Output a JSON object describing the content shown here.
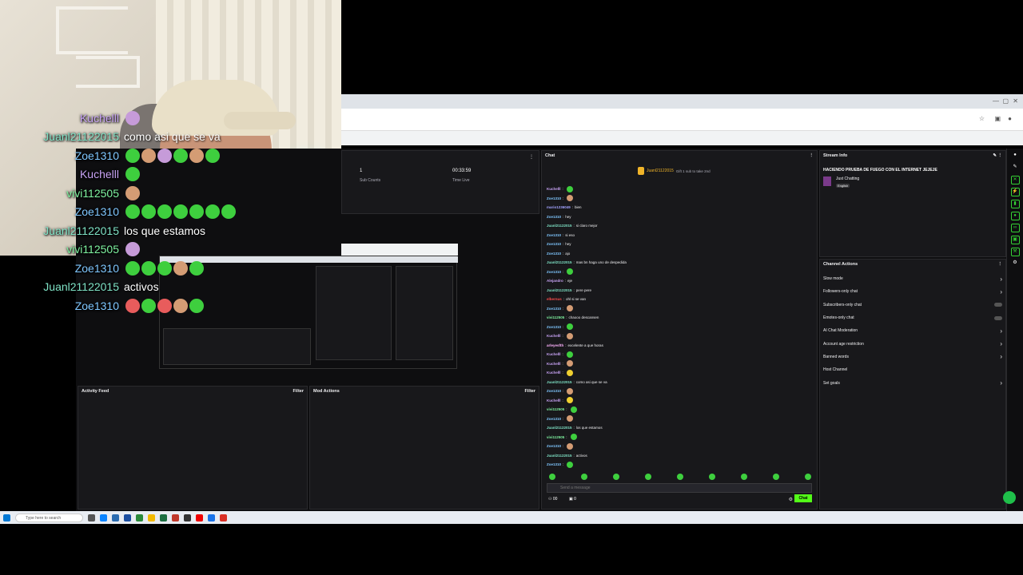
{
  "overlay_chat": [
    {
      "name": "Kuchelll",
      "color": "#c8a3f5",
      "text": "",
      "emotes": [
        "p"
      ]
    },
    {
      "name": "Juanl21122015",
      "color": "#7fe3c6",
      "text": "como asi que se va",
      "emotes": []
    },
    {
      "name": "Zoe1310",
      "color": "#7fc7ff",
      "text": "",
      "emotes": [
        "g",
        "t",
        "p",
        "g",
        "t",
        "g"
      ]
    },
    {
      "name": "Kuchelll",
      "color": "#c8a3f5",
      "text": "",
      "emotes": [
        "g"
      ]
    },
    {
      "name": "vivi112505",
      "color": "#7ff3a0",
      "text": "",
      "emotes": [
        "t"
      ]
    },
    {
      "name": "Zoe1310",
      "color": "#7fc7ff",
      "text": "",
      "emotes": [
        "g",
        "g",
        "g",
        "g",
        "g",
        "g",
        "g"
      ]
    },
    {
      "name": "Juanl21122015",
      "color": "#7fe3c6",
      "text": "los que estamos",
      "emotes": []
    },
    {
      "name": "vivi112505",
      "color": "#7ff3a0",
      "text": "",
      "emotes": [
        "p"
      ]
    },
    {
      "name": "Zoe1310",
      "color": "#7fc7ff",
      "text": "",
      "emotes": [
        "g",
        "g",
        "g",
        "t",
        "g"
      ]
    },
    {
      "name": "Juanl21122015",
      "color": "#7fe3c6",
      "text": "activos",
      "emotes": []
    },
    {
      "name": "Zoe1310",
      "color": "#7fc7ff",
      "text": "",
      "emotes": [
        "r",
        "g",
        "r",
        "t",
        "g"
      ]
    }
  ],
  "stats": {
    "sub_count_value": "1",
    "sub_count_label": "Sub Counts",
    "time_live_value": "00:33:59",
    "time_live_label": "Time Live"
  },
  "chat": {
    "title": "Chat",
    "top_user": "Juanl21122015",
    "top_note": "Gift 1 sub to take 2nd",
    "placeholder": "Send a message",
    "points": "00",
    "count": "0",
    "send_label": "Chat",
    "messages": [
      {
        "name": "Kuchelll",
        "color": "#c8a3f5",
        "text": ""
      },
      {
        "name": "Zoe1310",
        "color": "#7fc7ff",
        "text": ""
      },
      {
        "name": "mario1236049",
        "color": "#a3a3ff",
        "text": "bien"
      },
      {
        "name": "Zoe1310",
        "color": "#7fc7ff",
        "text": "hey"
      },
      {
        "name": "Juanl21122015",
        "color": "#7fe3c6",
        "text": "si claro mejor"
      },
      {
        "name": "Zoe1310",
        "color": "#7fc7ff",
        "text": "si eso"
      },
      {
        "name": "Zoe1310",
        "color": "#7fc7ff",
        "text": "hey"
      },
      {
        "name": "Zoe1310",
        "color": "#7fc7ff",
        "text": "ajo"
      },
      {
        "name": "Juanl21122015",
        "color": "#7fe3c6",
        "text": "mas bn haga uno de despedida"
      },
      {
        "name": "Zoe1310",
        "color": "#7fc7ff",
        "text": ""
      },
      {
        "name": "Alejandro",
        "color": "#c8a3f5",
        "text": "eje"
      },
      {
        "name": "Juanl21122015",
        "color": "#7fe3c6",
        "text": "pere pere"
      },
      {
        "name": "elbernus",
        "color": "#ff4d4d",
        "text": "ohl si se van"
      },
      {
        "name": "Zoe1310",
        "color": "#7fc7ff",
        "text": ""
      },
      {
        "name": "vivi112505",
        "color": "#7ff3a0",
        "text": "chaooo descansen"
      },
      {
        "name": "Zoe1310",
        "color": "#7fc7ff",
        "text": ""
      },
      {
        "name": "Kuchelll",
        "color": "#c8a3f5",
        "text": ""
      },
      {
        "name": "arleyesfth",
        "color": "#ffb3ff",
        "text": "excelente a que horas"
      },
      {
        "name": "Kuchelll",
        "color": "#c8a3f5",
        "text": ""
      },
      {
        "name": "Kuchelll",
        "color": "#c8a3f5",
        "text": ""
      },
      {
        "name": "Kuchelll",
        "color": "#c8a3f5",
        "text": ""
      },
      {
        "name": "Juanl21122015",
        "color": "#7fe3c6",
        "text": "como asi que se va"
      },
      {
        "name": "Zoe1310",
        "color": "#7fc7ff",
        "text": ""
      },
      {
        "name": "Kuchelll",
        "color": "#c8a3f5",
        "text": ""
      },
      {
        "name": "vivi112505",
        "color": "#7ff3a0",
        "text": ""
      },
      {
        "name": "Zoe1310",
        "color": "#7fc7ff",
        "text": ""
      },
      {
        "name": "Juanl21122015",
        "color": "#7fe3c6",
        "text": "los que estamos"
      },
      {
        "name": "vivi112505",
        "color": "#7ff3a0",
        "text": ""
      },
      {
        "name": "Zoe1310",
        "color": "#7fc7ff",
        "text": ""
      },
      {
        "name": "Juanl21122015",
        "color": "#7fe3c6",
        "text": "activos"
      },
      {
        "name": "Zoe1310",
        "color": "#7fc7ff",
        "text": ""
      }
    ]
  },
  "stream_info": {
    "title": "Stream Info",
    "stream_title": "HACIENDO PRUEBA DE FUEGO CON EL INTERNET JEJEJE",
    "category": "Just Chatting",
    "tag": "English"
  },
  "channel_actions": {
    "title": "Channel Actions",
    "items": [
      "Slow mode",
      "Followers-only chat",
      "Subscribers-only chat",
      "Emotes-only chat",
      "AI Chat Moderation",
      "Account age restriction",
      "Banned words",
      "Host Channel",
      "Set goals"
    ]
  },
  "activity_feed": {
    "title": "Activity Feed",
    "filter": "Filter"
  },
  "mod_actions": {
    "title": "Mod Actions",
    "filter": "Filter"
  },
  "taskbar": {
    "search_placeholder": "Type here to search"
  },
  "colors": {
    "accent": "#53fc18",
    "bg": "#0e0e10",
    "panel": "#18181b"
  }
}
